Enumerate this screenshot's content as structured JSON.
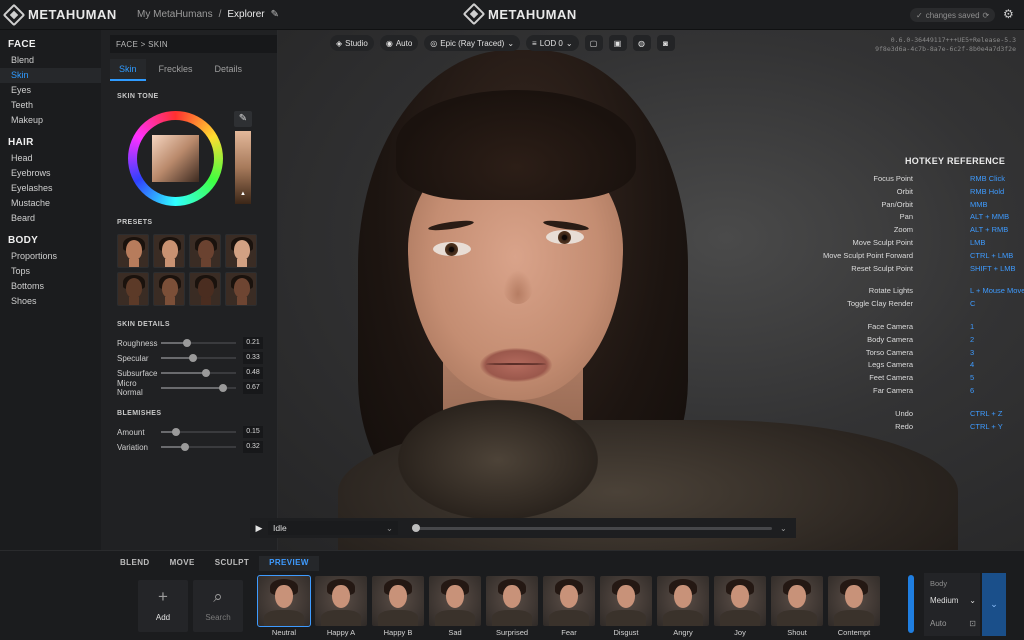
{
  "app": {
    "logo_text": "METAHUMAN",
    "center_logo_text": "METAHUMAN",
    "breadcrumb": [
      "My MetaHumans",
      "/",
      "Explorer"
    ],
    "save_status": "changes saved",
    "icons": {
      "edit": "pencil-icon",
      "settings": "gear-icon",
      "save": "check-icon"
    }
  },
  "nav": {
    "sections": [
      {
        "title": "FACE",
        "items": [
          "Blend",
          "Skin",
          "Eyes",
          "Teeth",
          "Makeup"
        ],
        "active": "Skin"
      },
      {
        "title": "HAIR",
        "items": [
          "Head",
          "Eyebrows",
          "Eyelashes",
          "Mustache",
          "Beard"
        ]
      },
      {
        "title": "BODY",
        "items": [
          "Proportions",
          "Tops",
          "Bottoms",
          "Shoes"
        ]
      }
    ]
  },
  "panel": {
    "crumb": "FACE  >  SKIN",
    "tabs": [
      "Skin",
      "Freckles",
      "Details"
    ],
    "active_tab": "Skin",
    "skin_tone_title": "SKIN TONE",
    "presets_title": "PRESETS",
    "skin_details_title": "SKIN DETAILS",
    "blemishes_title": "BLEMISHES",
    "presets": [
      {
        "skin": "#b77c5c"
      },
      {
        "skin": "#c99272"
      },
      {
        "skin": "#6a4230"
      },
      {
        "skin": "#d2a183"
      },
      {
        "skin": "#5c3a28"
      },
      {
        "skin": "#7b4f38"
      },
      {
        "skin": "#4a2d20"
      },
      {
        "skin": "#6e4532"
      }
    ],
    "skin_details": [
      {
        "label": "Roughness",
        "value": "0.21",
        "fraction": 0.35
      },
      {
        "label": "Specular",
        "value": "0.33",
        "fraction": 0.43
      },
      {
        "label": "Subsurface",
        "value": "0.48",
        "fraction": 0.6
      },
      {
        "label": "Micro Normal",
        "value": "0.67",
        "fraction": 0.82
      }
    ],
    "blemishes": [
      {
        "label": "Amount",
        "value": "0.15",
        "fraction": 0.2
      },
      {
        "label": "Variation",
        "value": "0.32",
        "fraction": 0.32
      }
    ]
  },
  "viewport": {
    "toolbar": {
      "studio": "Studio",
      "auto": "Auto",
      "quality": "Epic (Ray Traced)",
      "lod": "LOD 0"
    },
    "version_line1": "0.6.0-36449117+++UE5+Release-5.3",
    "version_line2": "9f8e3d6a-4c7b-8a7e-6c2f-8b0e4a7d3f2e",
    "hotkey_title": "HOTKEY REFERENCE",
    "hotkeys": [
      {
        "action": "Focus Point",
        "key": "RMB Click"
      },
      {
        "action": "Orbit",
        "key": "RMB Hold"
      },
      {
        "action": "Pan/Orbit",
        "key": "MMB"
      },
      {
        "action": "Pan",
        "key": "ALT + MMB"
      },
      {
        "action": "Zoom",
        "key": "ALT + RMB"
      },
      {
        "action": "Move Sculpt Point",
        "key": "LMB"
      },
      {
        "action": "Move Sculpt Point Forward",
        "key": "CTRL + LMB"
      },
      {
        "action": "Reset Sculpt Point",
        "key": "SHIFT + LMB"
      },
      {
        "action": "Rotate Lights",
        "key": "L + Mouse Move"
      },
      {
        "action": "Toggle Clay Render",
        "key": "C"
      },
      {
        "action": "Face Camera",
        "key": "1"
      },
      {
        "action": "Body Camera",
        "key": "2"
      },
      {
        "action": "Torso Camera",
        "key": "3"
      },
      {
        "action": "Legs Camera",
        "key": "4"
      },
      {
        "action": "Feet Camera",
        "key": "5"
      },
      {
        "action": "Far Camera",
        "key": "6"
      },
      {
        "action": "Undo",
        "key": "CTRL + Z"
      },
      {
        "action": "Redo",
        "key": "CTRL + Y"
      }
    ],
    "playback": {
      "animation": "Idle",
      "progress": 0.0
    }
  },
  "bottom": {
    "tabs": [
      "BLEND",
      "MOVE",
      "SCULPT",
      "PREVIEW"
    ],
    "active_tab": "PREVIEW",
    "add_label": "Add",
    "search_label": "Search",
    "poses": [
      "Neutral",
      "Happy A",
      "Happy B",
      "Sad",
      "Surprised",
      "Fear",
      "Disgust",
      "Angry",
      "Joy",
      "Shout",
      "Contempt"
    ],
    "active_pose": "Neutral",
    "body_label": "Body",
    "body_value": "Medium",
    "auto_label": "Auto"
  }
}
